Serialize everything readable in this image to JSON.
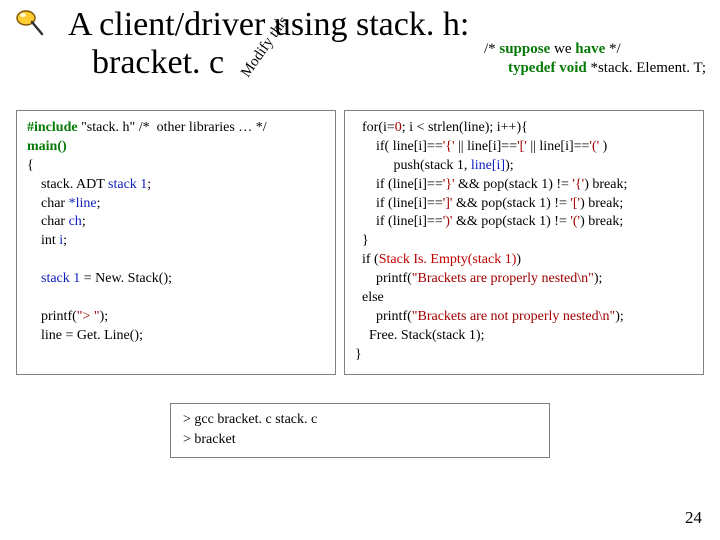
{
  "title_line1": "A client/driver using stack. h:",
  "title_line2": "bracket. c",
  "modify_label": "Modify this",
  "suppose": {
    "line1_prefix": "/* ",
    "line1_kw": "suppose",
    "line1_mid": " we ",
    "line1_kw2": "have",
    "line1_suffix": " */",
    "line2_kw": "typedef void",
    "line2_rest": " *stack. Element. T;"
  },
  "left_code": {
    "l1a": "#include",
    "l1b": " \"stack. h\" ",
    "l1c": "/*  other libraries … */",
    "l2": "main()",
    "l3": "{",
    "l4a": "    stack. ADT ",
    "l4b": "stack 1",
    "l4c": ";",
    "l5a": "    char ",
    "l5b": "*line",
    "l5c": ";",
    "l6a": "    char ",
    "l6b": "ch",
    "l6c": ";",
    "l7a": "    int ",
    "l7b": "i",
    "l7c": ";",
    "blank1": "",
    "l8a": "    stack 1",
    "l8b": " = New. Stack();",
    "blank2": "",
    "l9a": "    printf(",
    "l9b": "\"> \"",
    "l9c": ");",
    "l10": "    line = Get. Line();"
  },
  "right_code": {
    "l1a": "  for(i=",
    "l1b": "0",
    "l1c": "; i < strlen(line); i++){",
    "l2a": "      if( line[i]==",
    "l2b": "'{'",
    "l2c": " || line[i]==",
    "l2d": "'['",
    "l2e": " || line[i]==",
    "l2f": "'('",
    "l2g": " )",
    "l3a": "           push(stack 1, ",
    "l3b": "line[i]",
    "l3c": ");",
    "l4a": "      if (line[i]==",
    "l4b": "'}'",
    "l4c": " && pop(stack 1) != ",
    "l4d": "'{'",
    "l4e": ") break;",
    "l5a": "      if (line[i]==",
    "l5b": "']'",
    "l5c": " && pop(stack 1) != ",
    "l5d": "'['",
    "l5e": ") break;",
    "l6a": "      if (line[i]==",
    "l6b": "')'",
    "l6c": " && pop(stack 1) != ",
    "l6d": "'('",
    "l6e": ") break;",
    "l7": "  }",
    "l8a": "  if (",
    "l8b": "Stack Is. Empty(stack 1)",
    "l8c": ")",
    "l9a": "      printf(",
    "l9b": "\"Brackets are properly nested\\n\"",
    "l9c": ");",
    "l10": "  else",
    "l11a": "      printf(",
    "l11b": "\"Brackets are not properly nested\\n\"",
    "l11c": ");",
    "l12": "    Free. Stack(stack 1);",
    "l13": "}"
  },
  "cmd": {
    "l1": "> gcc bracket. c stack. c",
    "l2": "> bracket"
  },
  "page_number": "24"
}
